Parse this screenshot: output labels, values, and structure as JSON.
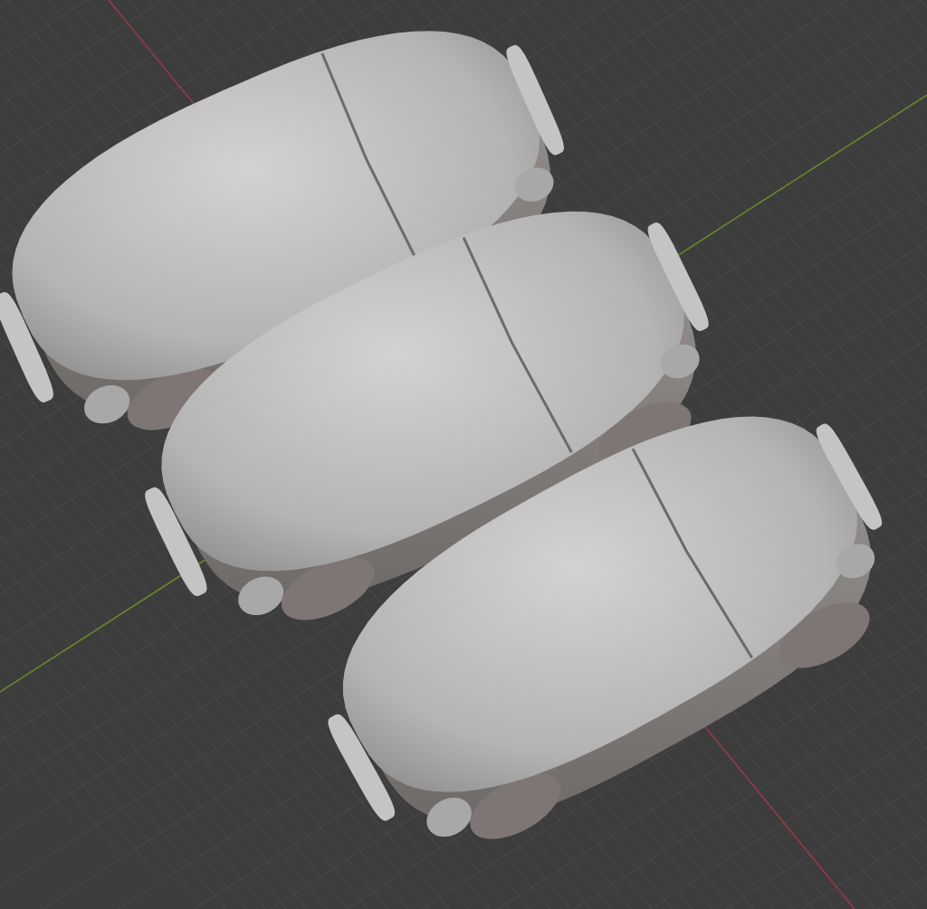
{
  "viewport": {
    "objects": [
      {
        "kind": "car"
      },
      {
        "kind": "car"
      },
      {
        "kind": "car"
      }
    ]
  }
}
